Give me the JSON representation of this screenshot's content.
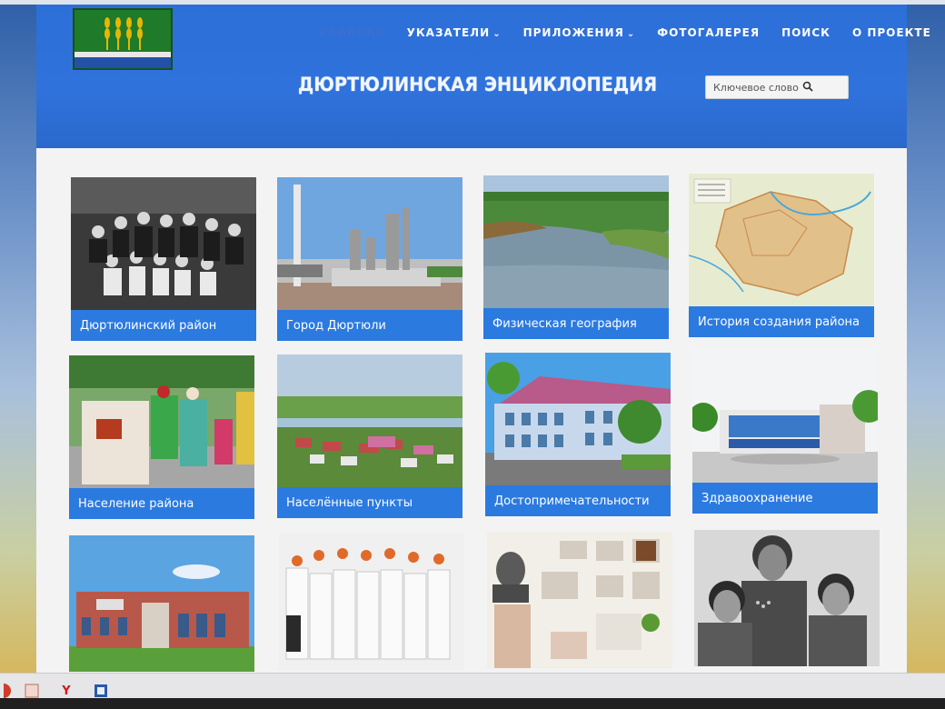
{
  "site": {
    "title": "ДЮРТЮЛИНСКАЯ ЭНЦИКЛОПЕДИЯ"
  },
  "nav": [
    {
      "label": "ГЛАВНАЯ",
      "active": true,
      "dropdown": false
    },
    {
      "label": "УКАЗАТЕЛИ",
      "active": false,
      "dropdown": true
    },
    {
      "label": "ПРИЛОЖЕНИЯ",
      "active": false,
      "dropdown": true
    },
    {
      "label": "ФОТОГАЛЕРЕЯ",
      "active": false,
      "dropdown": false
    },
    {
      "label": "ПОИСК",
      "active": false,
      "dropdown": false
    },
    {
      "label": "О ПРОЕКТЕ",
      "active": false,
      "dropdown": false
    }
  ],
  "search": {
    "placeholder": "Ключевое слово",
    "icon": "search-icon"
  },
  "cards": [
    {
      "label": "Дюртюлинский район",
      "image": "old-family-photo"
    },
    {
      "label": "Город Дюртюли",
      "image": "monument-square"
    },
    {
      "label": "Физическая география",
      "image": "river-landscape"
    },
    {
      "label": "История создания района",
      "image": "district-map"
    },
    {
      "label": "Население района",
      "image": "folk-festival"
    },
    {
      "label": "Населённые пункты",
      "image": "village-panorama"
    },
    {
      "label": "Достопримечательности",
      "image": "historic-building"
    },
    {
      "label": "Здравоохранение",
      "image": "hospital-building"
    },
    {
      "label": "",
      "image": "modern-building"
    },
    {
      "label": "",
      "image": "dance-ensemble"
    },
    {
      "label": "",
      "image": "museum-bust"
    },
    {
      "label": "",
      "image": "war-veterans-photo"
    }
  ],
  "colors": {
    "header": "#2f72dc",
    "caption": "#2b7ae0",
    "nav_active": "#3b6fd0",
    "content_bg": "#f3f3f3"
  },
  "taskbar": {
    "icons": [
      "app-red-icon",
      "app-box-icon",
      "yandex-browser-icon",
      "word-icon"
    ]
  }
}
